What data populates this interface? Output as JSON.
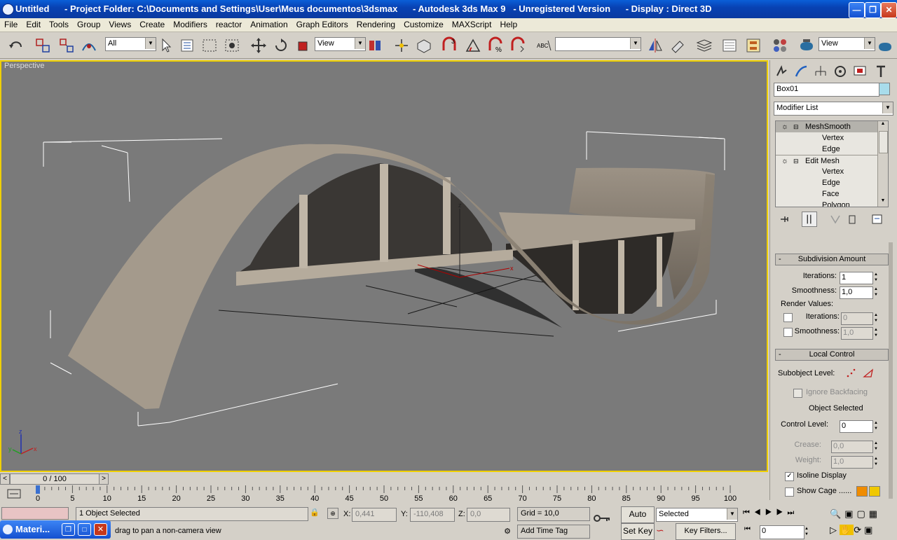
{
  "window": {
    "title": "Untitled      - Project Folder: C:\\Documents and Settings\\User\\Meus documentos\\3dsmax      - Autodesk 3ds Max 9   - Unregistered Version      - Display : Direct 3D",
    "buttons": [
      "minimize",
      "maximize",
      "close"
    ]
  },
  "menu": [
    "File",
    "Edit",
    "Tools",
    "Group",
    "Views",
    "Create",
    "Modifiers",
    "reactor",
    "Animation",
    "Graph Editors",
    "Rendering",
    "Customize",
    "MAXScript",
    "Help"
  ],
  "toolbar": {
    "selection_filter": "All",
    "ref_coord": "View",
    "named_selection": "",
    "view_dropdown": "View"
  },
  "viewport": {
    "label": "Perspective",
    "axis": {
      "x": "x",
      "y": "y",
      "z": "z"
    }
  },
  "command_panel": {
    "object_name": "Box01",
    "object_color": "#a8dceb",
    "modifier_list": "Modifier List",
    "stack": [
      {
        "label": "MeshSmooth",
        "level": 0
      },
      {
        "label": "Vertex",
        "level": 1
      },
      {
        "label": "Edge",
        "level": 1
      },
      {
        "label": "Edit Mesh",
        "level": 0
      },
      {
        "label": "Vertex",
        "level": 1
      },
      {
        "label": "Edge",
        "level": 1
      },
      {
        "label": "Face",
        "level": 1
      },
      {
        "label": "Polygon",
        "level": 1
      }
    ],
    "subdivision": {
      "header": "Subdivision Amount",
      "iterations_label": "Iterations:",
      "iterations": "1",
      "smoothness_label": "Smoothness:",
      "smoothness": "1,0",
      "render_values_label": "Render Values:",
      "render_iterations": "0",
      "render_smoothness": "1,0"
    },
    "local_control": {
      "header": "Local Control",
      "subobject_label": "Subobject Level:",
      "ignore_backfacing": "Ignore Backfacing",
      "selection_status": "Object Selected",
      "control_level_label": "Control Level:",
      "control_level": "0",
      "crease_label": "Crease:",
      "crease": "0,0",
      "weight_label": "Weight:",
      "weight": "1,0",
      "isoline_display": "Isoline Display",
      "show_cage": "Show Cage ......"
    },
    "cage_colors": [
      "#f08c00",
      "#f0c800"
    ]
  },
  "timeline": {
    "frame_display": "0 / 100",
    "ticks": [
      "0",
      "5",
      "10",
      "15",
      "20",
      "25",
      "30",
      "35",
      "40",
      "45",
      "50",
      "55",
      "60",
      "65",
      "70",
      "75",
      "80",
      "85",
      "90",
      "95",
      "100"
    ]
  },
  "status": {
    "selection": "1 Object Selected",
    "prompt": "drag to pan a non-camera view",
    "x_label": "X:",
    "x": "0,441",
    "y_label": "Y:",
    "y": "-110,408",
    "z_label": "Z:",
    "z": "0,0",
    "grid": "Grid = 10,0",
    "add_time_tag": "Add Time Tag",
    "auto_key": "Auto Key",
    "set_key": "Set Key",
    "key_mode": "Selected",
    "key_filters": "Key Filters...",
    "current_frame": "0"
  },
  "taskbar_item": "Materi..."
}
